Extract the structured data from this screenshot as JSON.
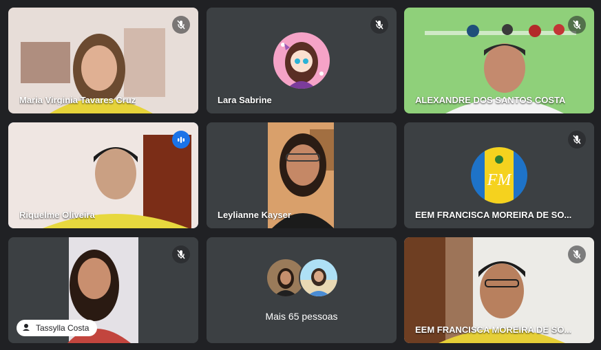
{
  "participants": [
    {
      "name": "Maria Virginia Tavares Cruz",
      "muted": true
    },
    {
      "name": "Lara Sabrine",
      "muted": true
    },
    {
      "name": "ALEXANDRE DOS SANTOS COSTA",
      "muted": true
    },
    {
      "name": "Riquelme Oliveira",
      "muted": false,
      "speaking": true
    },
    {
      "name": "Leylianne Kayser",
      "muted": false
    },
    {
      "name": "EEM FRANCISCA MOREIRA DE SO...",
      "muted": true
    },
    {
      "name": "Tassylla Costa",
      "muted": true
    },
    {
      "name": "EEM FRANCISCA MOREIRA DE SO...",
      "muted": true
    }
  ],
  "more_people_label": "Mais 65 pessoas",
  "colors": {
    "background": "#202124",
    "tile": "#3c4043",
    "speaking_outline": "#8ab4f8",
    "active_mic": "#1a73e8"
  }
}
